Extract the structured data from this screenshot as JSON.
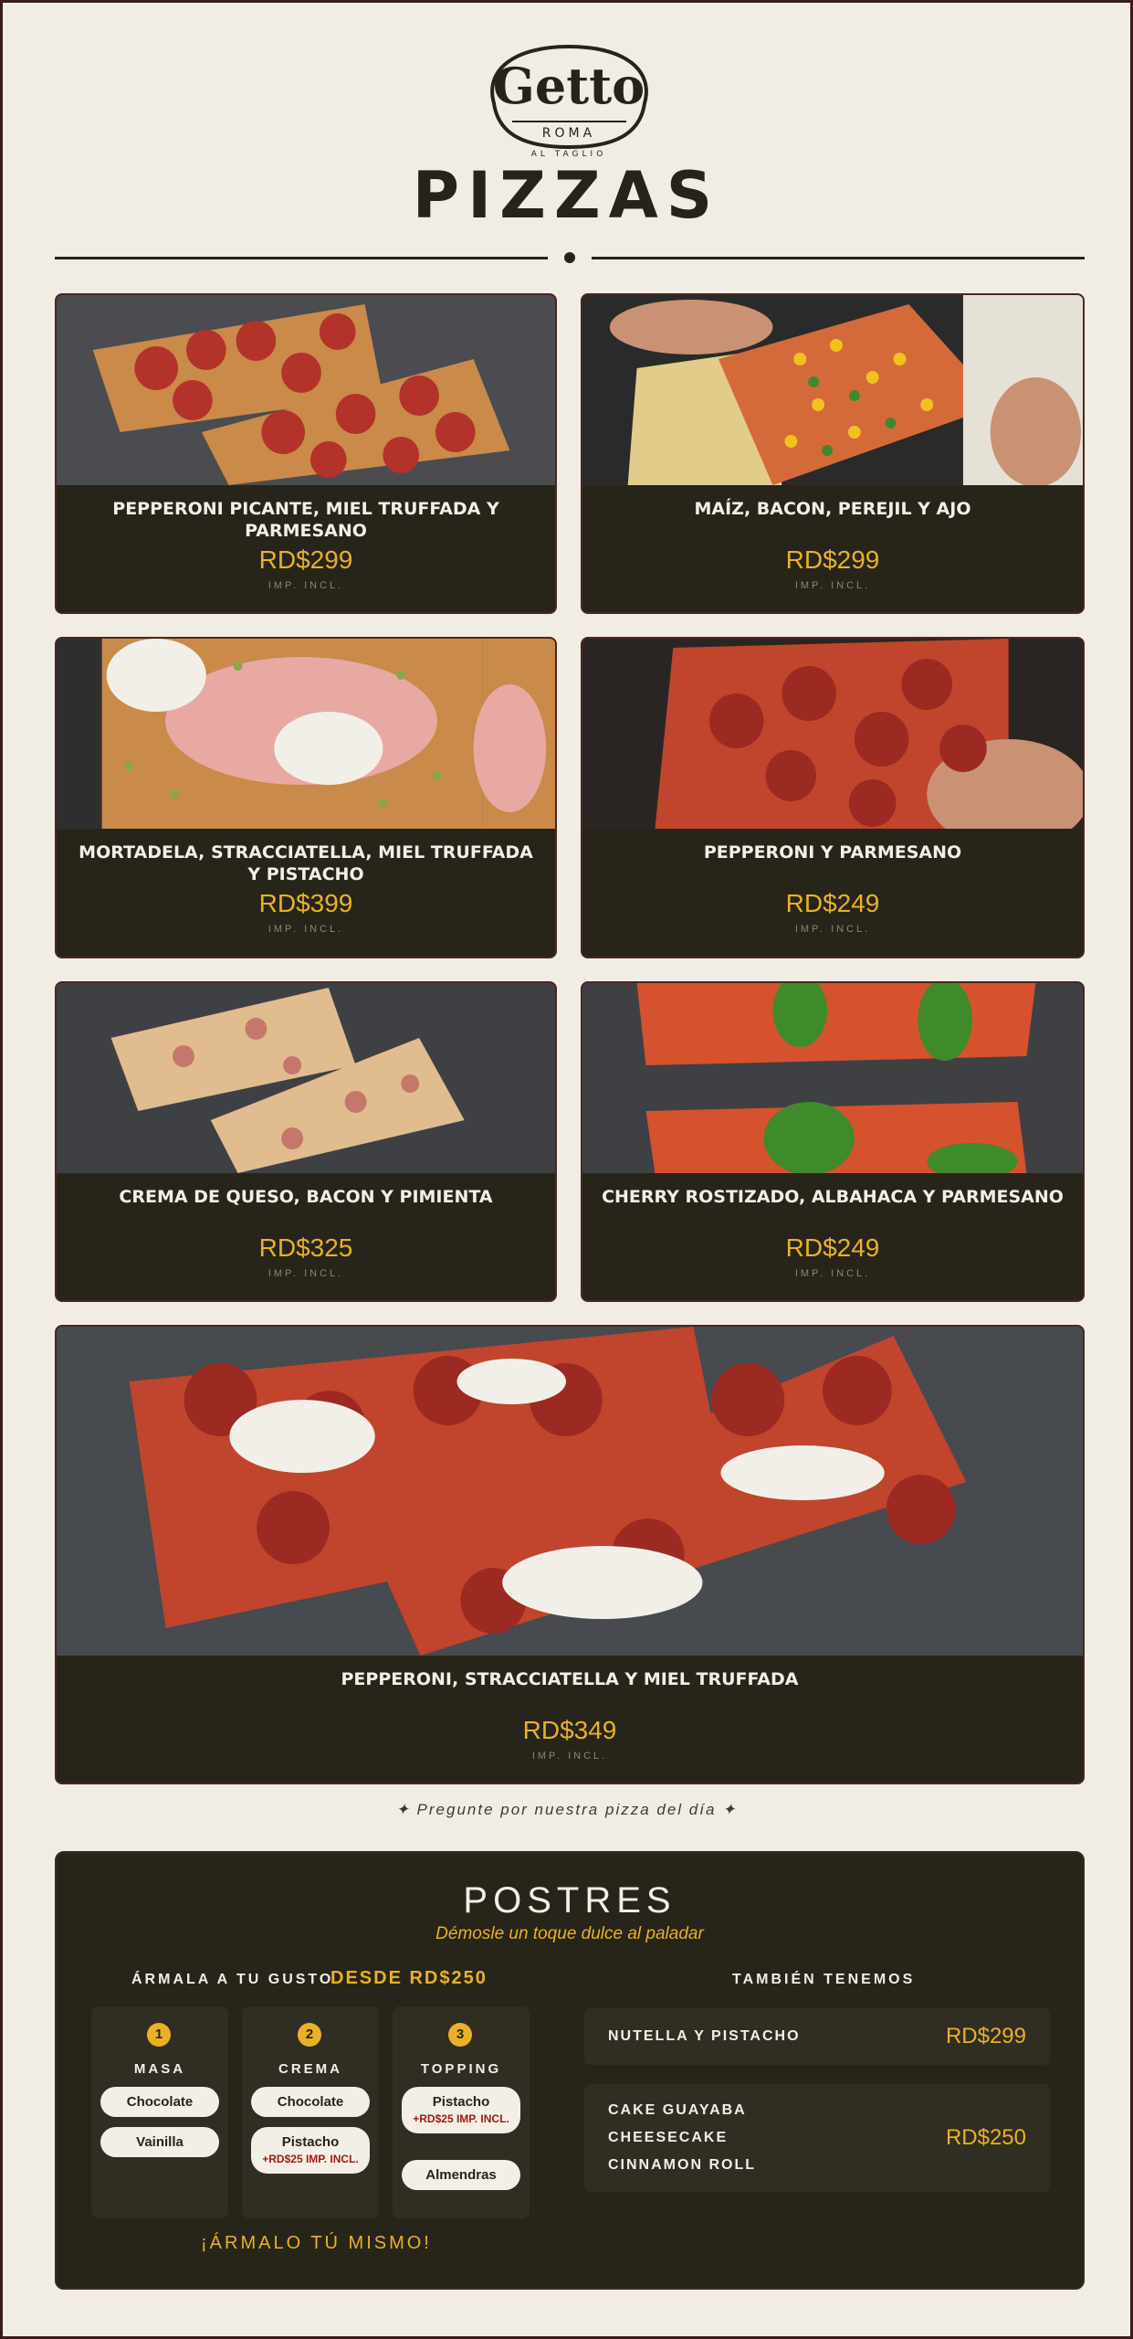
{
  "brand": {
    "logo_text": "Getto",
    "logo_sub": "ROMA",
    "logo_tag": "AL TAGLIO"
  },
  "section_title": "PIZZAS",
  "tax_label": "IMP. INCL.",
  "pizzas": [
    {
      "name": "PEPPERONI PICANTE, MIEL TRUFFADA Y PARMESANO",
      "price": "RD$299"
    },
    {
      "name": "MAÍZ, BACON, PEREJIL Y AJO",
      "price": "RD$299"
    },
    {
      "name": "MORTADELA, STRACCIATELLA, MIEL TRUFFADA Y PISTACHO",
      "price": "RD$399"
    },
    {
      "name": "PEPPERONI Y PARMESANO",
      "price": "RD$249"
    },
    {
      "name": "CREMA DE QUESO, BACON Y PIMIENTA",
      "price": "RD$325"
    },
    {
      "name": "CHERRY ROSTIZADO, ALBAHACA Y PARMESANO",
      "price": "RD$249"
    },
    {
      "name": "PEPPERONI, STRACCIATELLA Y MIEL TRUFFADA",
      "price": "RD$349"
    }
  ],
  "note": "✦ Pregunte por nuestra pizza del día ✦",
  "postres": {
    "title": "POSTRES",
    "subtitle": "Démosle un toque dulce al paladar",
    "build_heading": "ÁRMALA A TU GUSTO",
    "build_price": "DESDE RD$250",
    "also_heading": "TAMBIÉN TENEMOS",
    "steps": [
      {
        "num": "1",
        "label": "MASA",
        "options": [
          {
            "name": "Chocolate"
          },
          {
            "name": "Vainilla"
          }
        ]
      },
      {
        "num": "2",
        "label": "CREMA",
        "options": [
          {
            "name": "Chocolate"
          },
          {
            "name": "Pistacho",
            "extra": "+RD$25 IMP. INCL."
          }
        ]
      },
      {
        "num": "3",
        "label": "TOPPING",
        "options": [
          {
            "name": "Pistacho",
            "extra": "+RD$25 IMP. INCL."
          },
          {
            "name": "Almendras"
          }
        ]
      }
    ],
    "cta": "¡ÁRMALO TÚ MISMO!",
    "also": [
      {
        "items": [
          "NUTELLA Y PISTACHO"
        ],
        "price": "RD$299"
      },
      {
        "items": [
          "CAKE GUAYABA",
          "CHEESECAKE",
          "CINNAMON ROLL"
        ],
        "price": "RD$250"
      }
    ]
  },
  "colors": {
    "background": "#f1ede4",
    "card": "#27251a",
    "accent": "#e9b126",
    "text_light": "#f4efe6"
  }
}
